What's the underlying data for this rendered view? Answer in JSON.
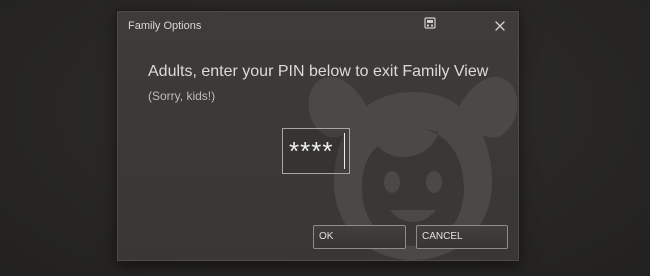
{
  "dialog": {
    "title": "Family Options",
    "title_icon": "family-view-icon",
    "close_icon": "close-icon",
    "headline": "Adults, enter your PIN below to exit Family View",
    "subline": "(Sorry, kids!)",
    "pin": {
      "masked_value": "****"
    },
    "buttons": {
      "ok_label": "OK",
      "cancel_label": "CANCEL"
    },
    "watermark_icon": "kid-face-icon"
  },
  "colors": {
    "dialog_background": "#3b3936",
    "page_background": "#292826",
    "text": "#dcdbd8"
  }
}
